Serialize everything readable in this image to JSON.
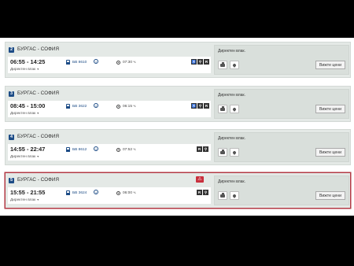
{
  "results": [
    {
      "number": "2",
      "route": "БУРГАС - СОФИЯ",
      "times": "06:55 - 14:25",
      "sub_label": "Директен влак",
      "train_no": "БВ 8610",
      "duration": "07:30 ч.",
      "facilities": [
        "accessible-icon",
        "bicycle-icon",
        "seat-reservation-icon"
      ],
      "has_alert": false,
      "selected": false,
      "note": "Директен влак.",
      "prices_label": "Вижте цени"
    },
    {
      "number": "3",
      "route": "БУРГАС - СОФИЯ",
      "times": "08:45 - 15:00",
      "sub_label": "Директен влак",
      "train_no": "БВ 3622",
      "duration": "06:15 ч.",
      "facilities": [
        "accessible-icon",
        "bicycle-icon",
        "seat-reservation-icon"
      ],
      "has_alert": false,
      "selected": false,
      "note": "Директен влак.",
      "prices_label": "Вижте цени"
    },
    {
      "number": "4",
      "route": "БУРГАС - СОФИЯ",
      "times": "14:55 - 22:47",
      "sub_label": "Директен влак",
      "train_no": "БВ 8612",
      "duration": "07:52 ч.",
      "facilities": [
        "seat-reservation-icon",
        "bicycle-icon"
      ],
      "has_alert": false,
      "selected": false,
      "note": "Директен влак.",
      "prices_label": "Вижте цени"
    },
    {
      "number": "5",
      "route": "БУРГАС - СОФИЯ",
      "times": "15:55 - 21:55",
      "sub_label": "Директен влак",
      "train_no": "БВ 3624",
      "duration": "06:00 ч.",
      "facilities": [
        "seat-reservation-icon",
        "bicycle-icon"
      ],
      "has_alert": true,
      "selected": true,
      "note": "Директен влак.",
      "prices_label": "Вижте цени"
    }
  ],
  "icons": {
    "caret": "▾",
    "info": "i",
    "alert": "⚠",
    "accessible-icon": "♿",
    "bicycle-icon": "⚲",
    "seat-reservation-icon": "R"
  },
  "colors": {
    "brand_blue": "#1d4c86",
    "alert_red": "#c8303d",
    "selected_border": "#b33a45"
  }
}
